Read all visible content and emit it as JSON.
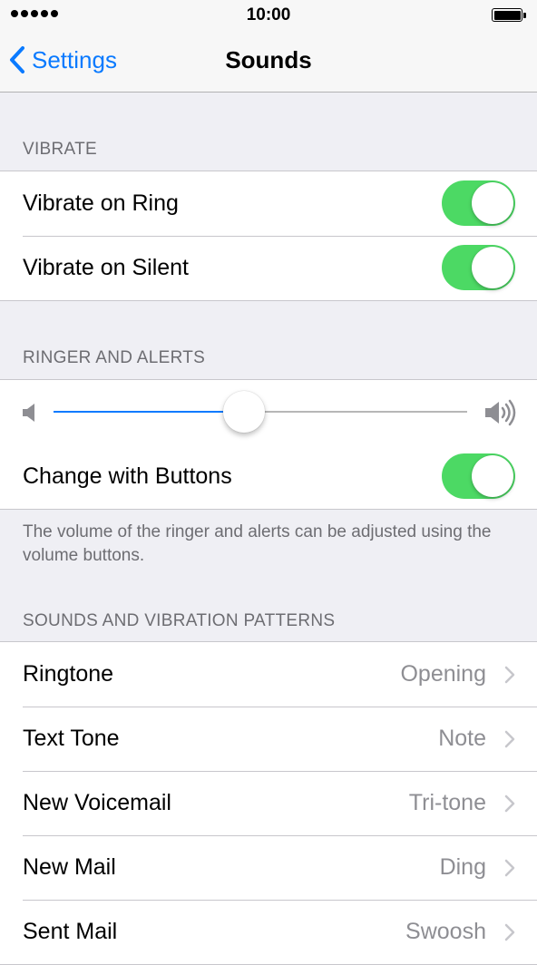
{
  "status_bar": {
    "time": "10:00"
  },
  "nav": {
    "back_label": "Settings",
    "title": "Sounds"
  },
  "vibrate": {
    "header": "VIBRATE",
    "items": [
      {
        "label": "Vibrate on Ring",
        "on": true
      },
      {
        "label": "Vibrate on Silent",
        "on": true
      }
    ]
  },
  "ringer": {
    "header": "RINGER AND ALERTS",
    "volume_level": 0.46,
    "change_with_buttons": {
      "label": "Change with Buttons",
      "on": true
    },
    "footnote": "The volume of the ringer and alerts can be adjusted using the volume buttons."
  },
  "patterns": {
    "header": "SOUNDS AND VIBRATION PATTERNS",
    "items": [
      {
        "label": "Ringtone",
        "value": "Opening"
      },
      {
        "label": "Text Tone",
        "value": "Note"
      },
      {
        "label": "New Voicemail",
        "value": "Tri-tone"
      },
      {
        "label": "New Mail",
        "value": "Ding"
      },
      {
        "label": "Sent Mail",
        "value": "Swoosh"
      }
    ]
  },
  "colors": {
    "accent": "#0a7aff",
    "toggle_on": "#4cd964"
  }
}
